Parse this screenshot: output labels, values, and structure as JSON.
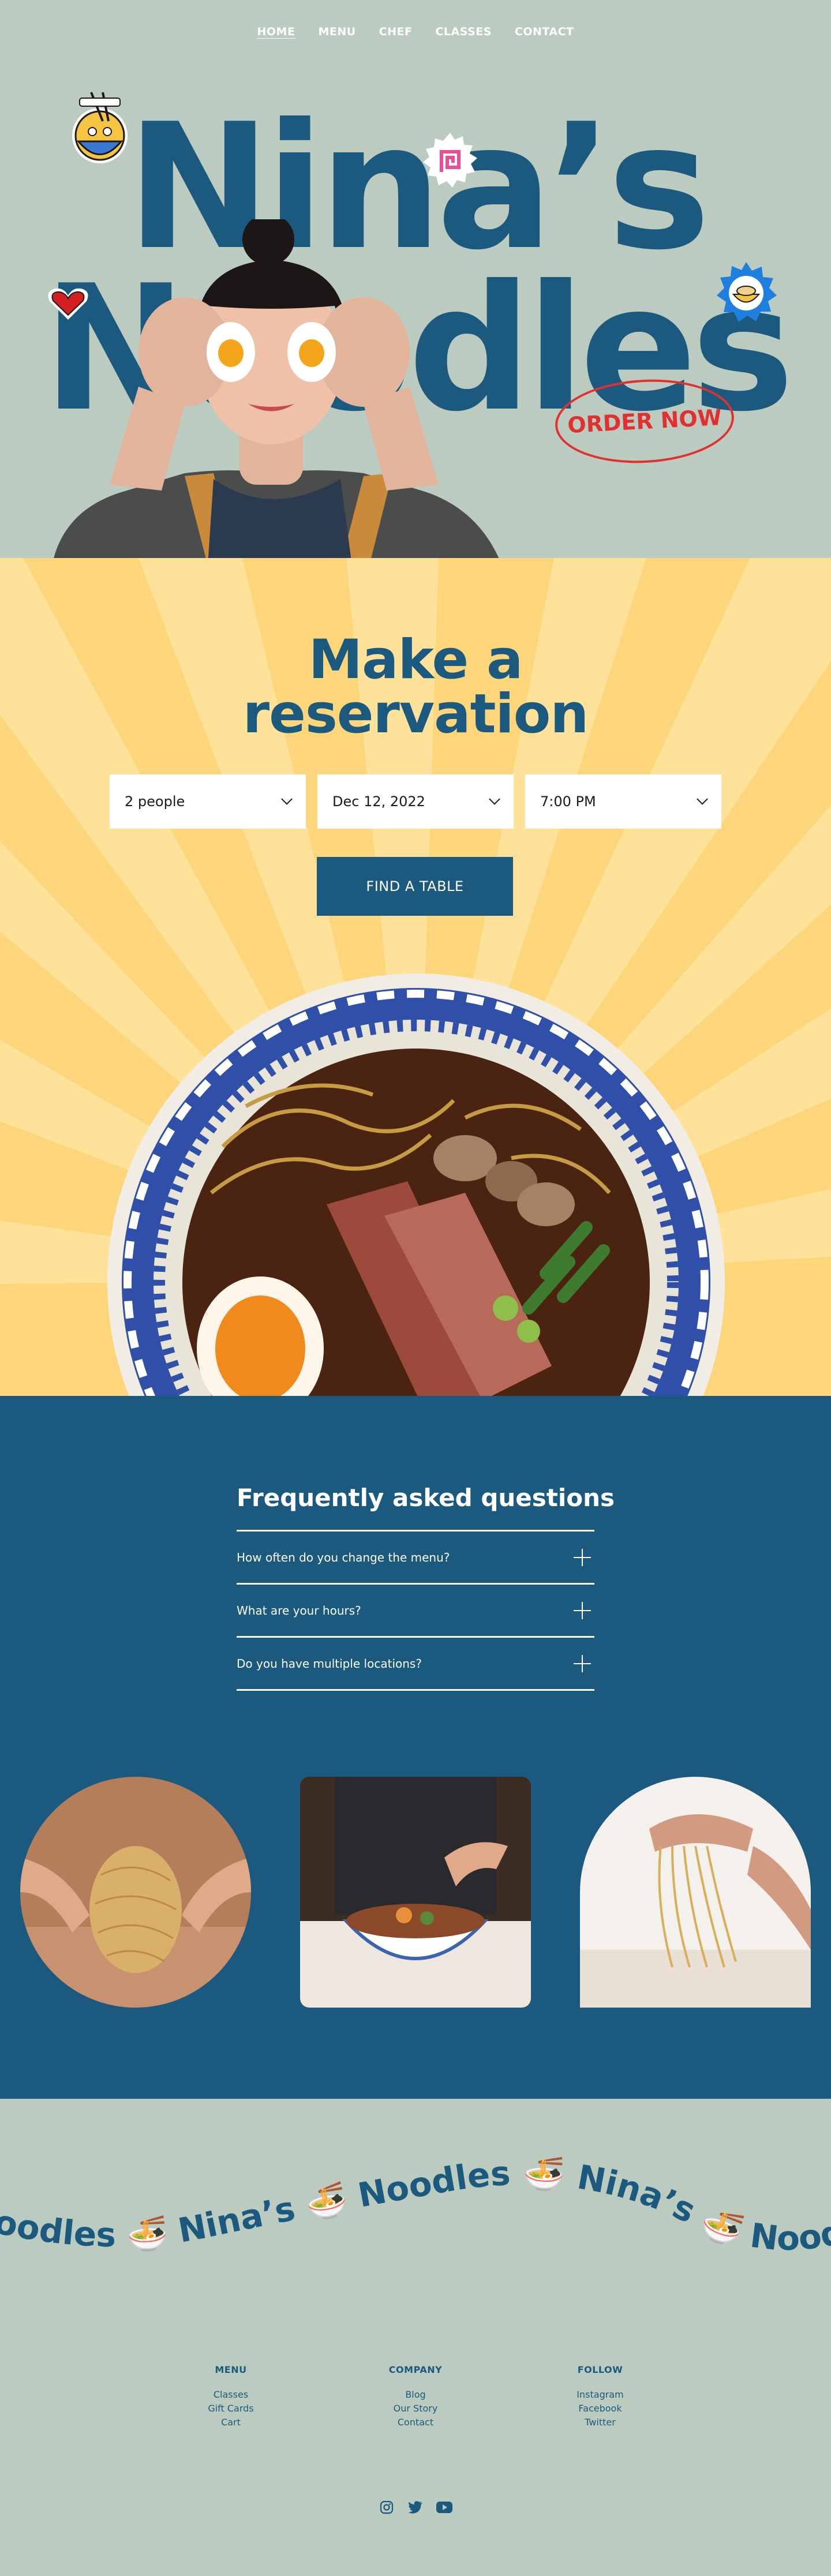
{
  "nav": {
    "items": [
      {
        "label": "HOME",
        "active": true
      },
      {
        "label": "MENU",
        "active": false
      },
      {
        "label": "CHEF",
        "active": false
      },
      {
        "label": "CLASSES",
        "active": false
      },
      {
        "label": "CONTACT",
        "active": false
      }
    ]
  },
  "hero": {
    "title_line1": "Nina’s",
    "title_line2": "Noodles",
    "order_label": "ORDER NOW"
  },
  "reservation": {
    "heading_line1": "Make a",
    "heading_line2": "reservation",
    "party_size": "2 people",
    "date": "Dec 12, 2022",
    "time": "7:00 PM",
    "button_label": "FIND A TABLE"
  },
  "faq": {
    "title": "Frequently asked questions",
    "items": [
      {
        "question": "How often do you change the menu?"
      },
      {
        "question": "What are your hours?"
      },
      {
        "question": "Do you have multiple locations?"
      }
    ]
  },
  "footer": {
    "marquee_text": "Noodles 🍜 Nina’s 🍜 Noodles 🍜 Nina’s 🍜 Noodles 🍜 Nina’s 🍜 Noodles 🍜 Nina’s",
    "columns": [
      {
        "title": "MENU",
        "links": [
          "Classes",
          "Gift Cards",
          "Cart"
        ]
      },
      {
        "title": "COMPANY",
        "links": [
          "Blog",
          "Our Story",
          "Contact"
        ]
      },
      {
        "title": "FOLLOW",
        "links": [
          "Instagram",
          "Facebook",
          "Twitter"
        ]
      }
    ],
    "socials": [
      "instagram-icon",
      "twitter-icon",
      "youtube-icon"
    ]
  },
  "colors": {
    "sage": "#bccbbf",
    "navy": "#1b5a7e",
    "yellow": "#fdd57a",
    "red": "#e03030"
  }
}
